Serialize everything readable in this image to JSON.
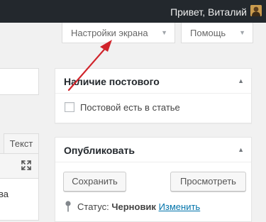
{
  "adminbar": {
    "greeting": "Привет, Виталий"
  },
  "screen_meta": {
    "screen_options_label": "Настройки экрана",
    "help_label": "Помощь"
  },
  "editor": {
    "text_tab_label": "Текст",
    "content_fragment": "ва"
  },
  "stock_box": {
    "title": "Наличие постового",
    "checkbox_label": "Постовой есть в статье",
    "checked": false
  },
  "publish_box": {
    "title": "Опубликовать",
    "save_label": "Сохранить",
    "preview_label": "Просмотреть",
    "status_label": "Статус:",
    "status_value": "Черновик",
    "edit_link": "Изменить"
  },
  "colors": {
    "adminbar_bg": "#23282d",
    "link": "#0073aa",
    "annotation_arrow": "#d0242b"
  },
  "icons": {
    "avatar": "user-avatar",
    "toggle": "caret-up-icon",
    "tab_caret": "caret-down-icon",
    "expand": "fullscreen-expand-icon",
    "status": "pin-icon"
  }
}
